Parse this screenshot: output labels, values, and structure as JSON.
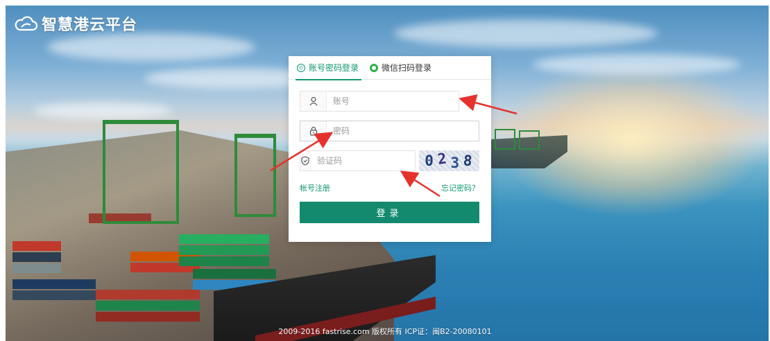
{
  "app": {
    "logo_text": "智慧港云平台"
  },
  "login": {
    "tabs": [
      {
        "label": "账号密码登录",
        "active": true
      },
      {
        "label": "微信扫码登录",
        "active": false
      }
    ],
    "username": {
      "placeholder": "账号",
      "value": ""
    },
    "password": {
      "placeholder": "密码",
      "value": ""
    },
    "captcha": {
      "placeholder": "验证码",
      "value": "",
      "image_text": [
        "0",
        "2",
        "3",
        "8"
      ]
    },
    "register_link": "帐号注册",
    "forgot_link": "忘记密码？",
    "submit_label": "登录"
  },
  "footer": {
    "text": "2009-2016 fastrise.com 版权所有 ICP证：闽B2-20080101"
  },
  "colors": {
    "accent": "#139872",
    "button": "#138a6e",
    "annotation_arrow": "#e5322d"
  }
}
